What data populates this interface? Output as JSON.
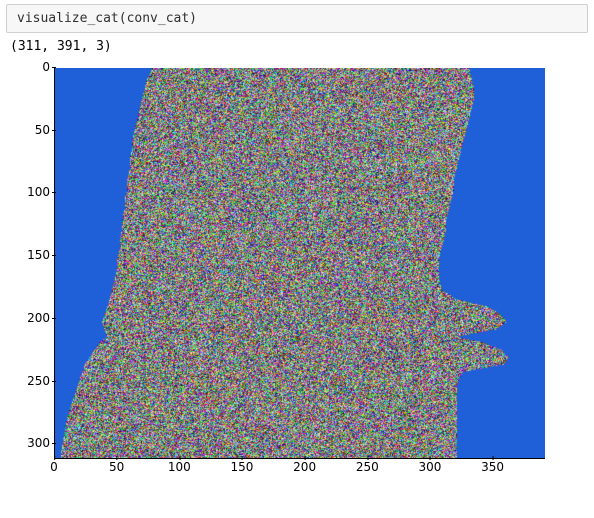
{
  "code_cell": {
    "content": "visualize_cat(conv_cat)"
  },
  "output": {
    "shape_text": "(311, 391, 3)"
  },
  "chart_data": {
    "type": "heatmap",
    "title": "",
    "xlabel": "",
    "ylabel": "",
    "xlim": [
      0,
      391
    ],
    "ylim": [
      311,
      0
    ],
    "x_ticks": [
      0,
      50,
      100,
      150,
      200,
      250,
      300,
      350
    ],
    "y_ticks": [
      0,
      50,
      100,
      150,
      200,
      250,
      300
    ],
    "note": "Image-like array (311×391×3). Foreground region (cat silhouette) rendered as multi-color noise; background is solid blue.",
    "background_color": "#1f5fd8",
    "mask_rows": [
      {
        "y": 0,
        "x0": 78,
        "x1": 330
      },
      {
        "y": 8,
        "x0": 74,
        "x1": 332
      },
      {
        "y": 16,
        "x0": 72,
        "x1": 334
      },
      {
        "y": 24,
        "x0": 70,
        "x1": 334
      },
      {
        "y": 32,
        "x0": 68,
        "x1": 332
      },
      {
        "y": 40,
        "x0": 66,
        "x1": 330
      },
      {
        "y": 48,
        "x0": 64,
        "x1": 328
      },
      {
        "y": 56,
        "x0": 62,
        "x1": 326
      },
      {
        "y": 64,
        "x0": 62,
        "x1": 324
      },
      {
        "y": 72,
        "x0": 60,
        "x1": 322
      },
      {
        "y": 80,
        "x0": 60,
        "x1": 320
      },
      {
        "y": 88,
        "x0": 58,
        "x1": 318
      },
      {
        "y": 96,
        "x0": 58,
        "x1": 318
      },
      {
        "y": 104,
        "x0": 56,
        "x1": 316
      },
      {
        "y": 112,
        "x0": 56,
        "x1": 314
      },
      {
        "y": 120,
        "x0": 54,
        "x1": 312
      },
      {
        "y": 128,
        "x0": 54,
        "x1": 312
      },
      {
        "y": 136,
        "x0": 52,
        "x1": 310
      },
      {
        "y": 144,
        "x0": 52,
        "x1": 308
      },
      {
        "y": 152,
        "x0": 50,
        "x1": 306
      },
      {
        "y": 160,
        "x0": 50,
        "x1": 306
      },
      {
        "y": 168,
        "x0": 48,
        "x1": 306
      },
      {
        "y": 176,
        "x0": 46,
        "x1": 308
      },
      {
        "y": 184,
        "x0": 44,
        "x1": 320
      },
      {
        "y": 190,
        "x0": 42,
        "x1": 345
      },
      {
        "y": 196,
        "x0": 40,
        "x1": 355
      },
      {
        "y": 202,
        "x0": 38,
        "x1": 360
      },
      {
        "y": 208,
        "x0": 40,
        "x1": 352
      },
      {
        "y": 214,
        "x0": 42,
        "x1": 320
      },
      {
        "y": 218,
        "x0": 36,
        "x1": 340
      },
      {
        "y": 224,
        "x0": 32,
        "x1": 355
      },
      {
        "y": 230,
        "x0": 28,
        "x1": 362
      },
      {
        "y": 236,
        "x0": 24,
        "x1": 358
      },
      {
        "y": 242,
        "x0": 22,
        "x1": 325
      },
      {
        "y": 248,
        "x0": 20,
        "x1": 322
      },
      {
        "y": 254,
        "x0": 18,
        "x1": 320
      },
      {
        "y": 260,
        "x0": 16,
        "x1": 320
      },
      {
        "y": 266,
        "x0": 14,
        "x1": 320
      },
      {
        "y": 272,
        "x0": 12,
        "x1": 320
      },
      {
        "y": 278,
        "x0": 10,
        "x1": 320
      },
      {
        "y": 284,
        "x0": 9,
        "x1": 320
      },
      {
        "y": 290,
        "x0": 8,
        "x1": 320
      },
      {
        "y": 296,
        "x0": 7,
        "x1": 320
      },
      {
        "y": 302,
        "x0": 6,
        "x1": 320
      },
      {
        "y": 308,
        "x0": 5,
        "x1": 320
      }
    ]
  }
}
